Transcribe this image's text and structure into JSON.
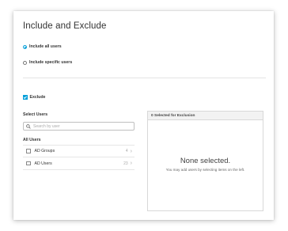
{
  "title": "Include and Exclude",
  "scope": {
    "options": [
      {
        "label": "Include all users",
        "selected": true
      },
      {
        "label": "Include specific users",
        "selected": false
      }
    ]
  },
  "exclude": {
    "label": "Exclude",
    "checked": true
  },
  "select_users": {
    "label": "Select Users",
    "search_placeholder": "Search by user",
    "group_heading": "All Users",
    "items": [
      {
        "label": "AD Groups",
        "count": "4"
      },
      {
        "label": "AD Users",
        "count": "23"
      }
    ]
  },
  "selection_panel": {
    "header": "0 Selected for Exclusion",
    "empty_title": "None selected.",
    "empty_hint": "You may add users by selecting items on the left."
  },
  "colors": {
    "accent": "#049fd9",
    "icon": "chevron-right-icon"
  }
}
